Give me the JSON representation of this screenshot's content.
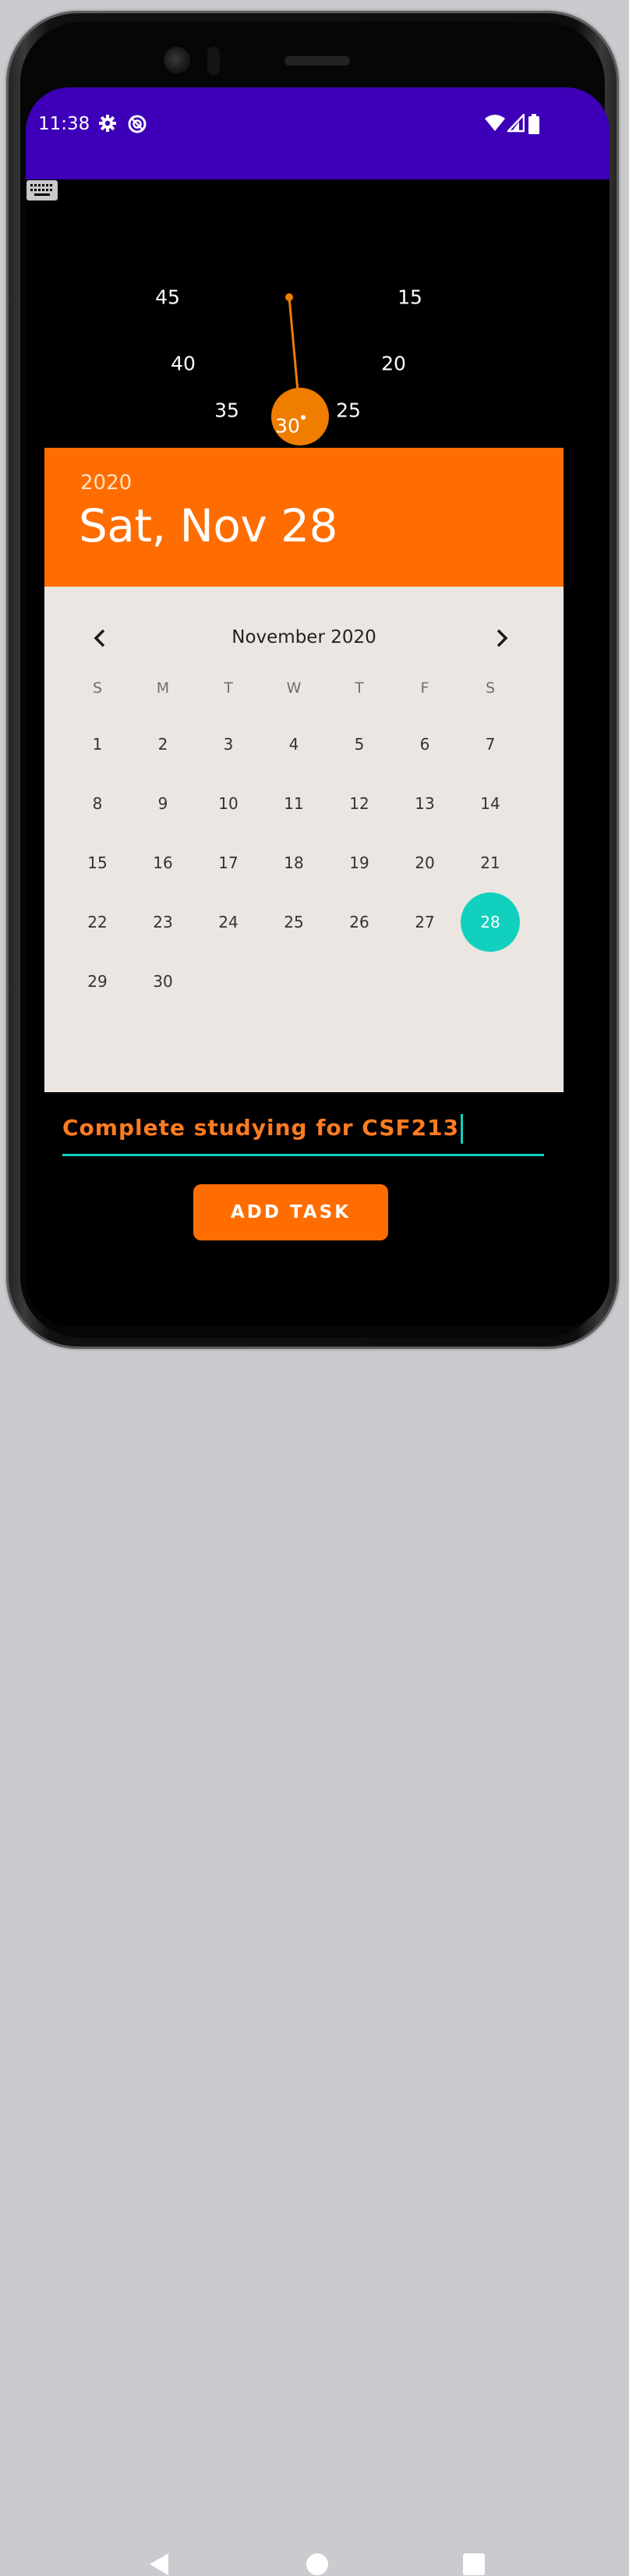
{
  "status_bar": {
    "time": "11:38",
    "icons": [
      "settings-icon",
      "sync-icon",
      "wifi-icon",
      "signal-icon",
      "battery-icon"
    ],
    "background": "#3d00b8"
  },
  "time_picker": {
    "minutes": [
      "45",
      "15",
      "40",
      "20",
      "35",
      "25"
    ],
    "selected": "30",
    "accent": "#ef7d00",
    "mode_icon": "keyboard-icon"
  },
  "date_picker": {
    "year": "2020",
    "date": "Sat, Nov 28",
    "month": "November 2020",
    "days_of_week": [
      "S",
      "M",
      "T",
      "W",
      "T",
      "F",
      "S"
    ],
    "days": [
      "1",
      "2",
      "3",
      "4",
      "5",
      "6",
      "7",
      "8",
      "9",
      "10",
      "11",
      "12",
      "13",
      "14",
      "15",
      "16",
      "17",
      "18",
      "19",
      "20",
      "21",
      "22",
      "23",
      "24",
      "25",
      "26",
      "27",
      "28",
      "29",
      "30"
    ],
    "first_weekday_index": 0,
    "selected_day": "28",
    "header_color": "#ff6d00",
    "selection_color": "#11d1be"
  },
  "task": {
    "value": "Complete studying for CSF213",
    "add_label": "ADD TASK"
  },
  "navigation": [
    "back-icon",
    "home-icon",
    "recents-icon"
  ]
}
